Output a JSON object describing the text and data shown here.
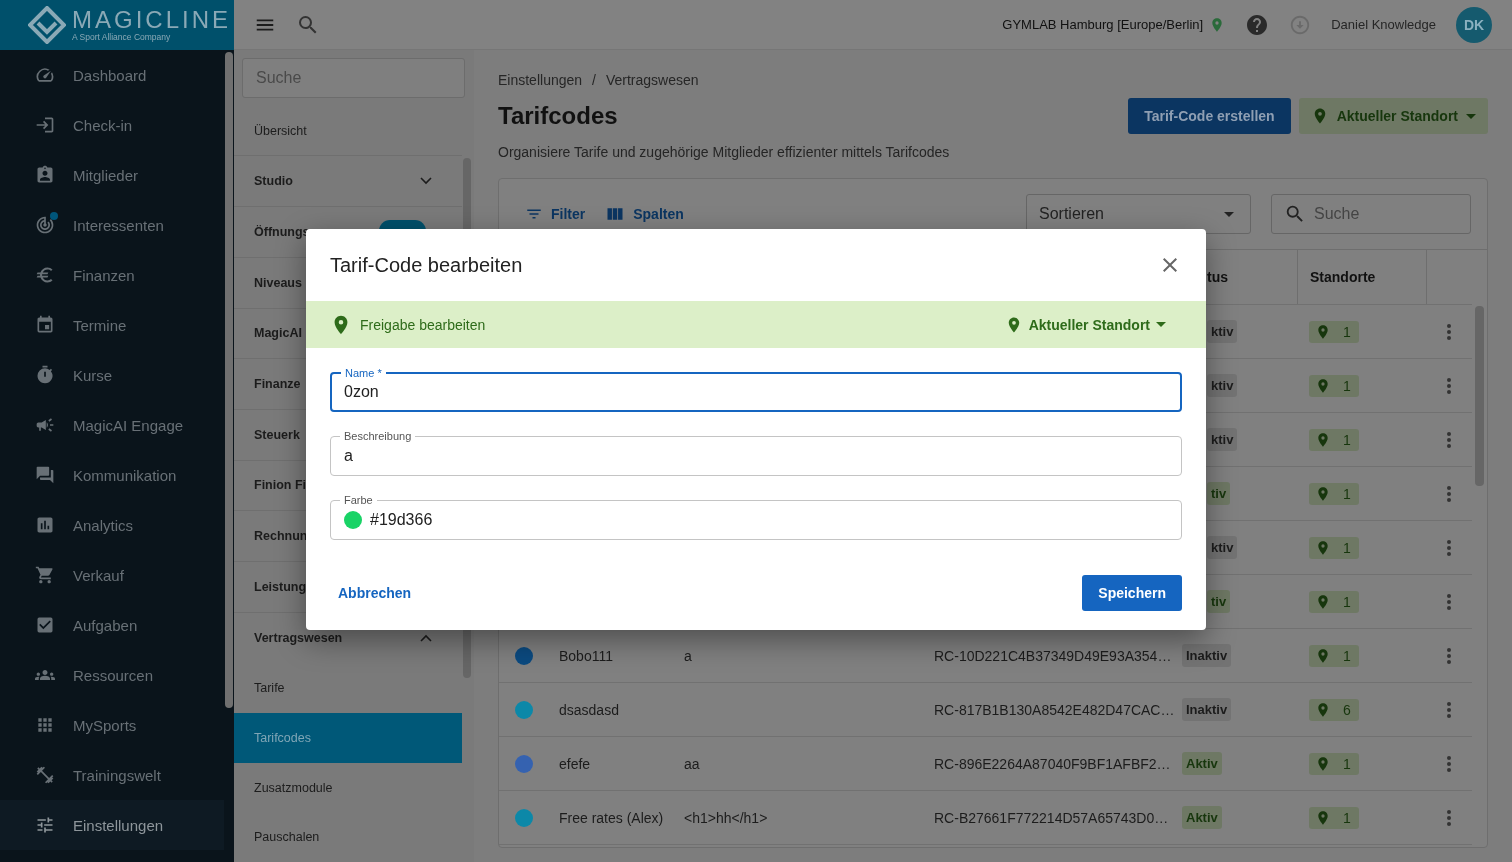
{
  "app": {
    "logo": "MAGICLINE",
    "tagline": "A Sport Alliance Company"
  },
  "topbar": {
    "location": "GYMLAB Hamburg [Europe/Berlin]",
    "user": "Daniel Knowledge",
    "avatar": "DK"
  },
  "nav": [
    {
      "label": "Dashboard",
      "selected": false,
      "notification": false
    },
    {
      "label": "Check-in",
      "selected": false,
      "notification": false
    },
    {
      "label": "Mitglieder",
      "selected": false,
      "notification": false
    },
    {
      "label": "Interessenten",
      "selected": false,
      "notification": true
    },
    {
      "label": "Finanzen",
      "selected": false,
      "notification": false
    },
    {
      "label": "Termine",
      "selected": false,
      "notification": false
    },
    {
      "label": "Kurse",
      "selected": false,
      "notification": false
    },
    {
      "label": "MagicAI Engage",
      "selected": false,
      "notification": false
    },
    {
      "label": "Kommunikation",
      "selected": false,
      "notification": false
    },
    {
      "label": "Analytics",
      "selected": false,
      "notification": false
    },
    {
      "label": "Verkauf",
      "selected": false,
      "notification": false
    },
    {
      "label": "Aufgaben",
      "selected": false,
      "notification": false
    },
    {
      "label": "Ressourcen",
      "selected": false,
      "notification": false
    },
    {
      "label": "MySports",
      "selected": false,
      "notification": false
    },
    {
      "label": "Trainingswelt",
      "selected": false,
      "notification": false
    },
    {
      "label": "Einstellungen",
      "selected": true,
      "notification": false
    }
  ],
  "settings_nav": {
    "search_placeholder": "Suche",
    "items": [
      {
        "kind": "link",
        "label": "Übersicht",
        "selected": false
      },
      {
        "kind": "group",
        "label": "Studio",
        "expanded": false,
        "badge": false
      },
      {
        "kind": "group",
        "label": "Öffnungs",
        "badge": true
      },
      {
        "kind": "group",
        "label": "Niveaus",
        "badge": false
      },
      {
        "kind": "group",
        "label": "MagicAI",
        "badge": false
      },
      {
        "kind": "group",
        "label": "Finanze",
        "badge": false
      },
      {
        "kind": "group",
        "label": "Steuerk",
        "badge": false
      },
      {
        "kind": "group",
        "label": "Finion Fi",
        "badge": false
      },
      {
        "kind": "group",
        "label": "Rechnun",
        "badge": false
      },
      {
        "kind": "group",
        "label": "Leistung",
        "badge": false
      },
      {
        "kind": "group",
        "label": "Vertragswesen",
        "expanded": true,
        "badge": false,
        "children": [
          {
            "label": "Tarife",
            "selected": false
          },
          {
            "label": "Tarifcodes",
            "selected": true
          },
          {
            "label": "Zusatzmodule",
            "selected": false
          },
          {
            "label": "Pauschalen",
            "selected": false
          }
        ]
      }
    ]
  },
  "main": {
    "breadcrumb": [
      "Einstellungen",
      "Vertragswesen"
    ],
    "breadcrumb_separator": "/",
    "title": "Tarifcodes",
    "subtitle": "Organisiere Tarife und zugehörige Mitglieder effizienter mittels Tarifcodes",
    "create_button": "Tarif-Code erstellen",
    "location_button": "Aktueller Standort",
    "toolbar": {
      "filter": "Filter",
      "columns": "Spalten",
      "sort_placeholder": "Sortieren",
      "search_placeholder": "Suche"
    },
    "table": {
      "columns": [
        {
          "label": "tus"
        },
        {
          "label": "Standorte"
        }
      ],
      "rows": [
        {
          "kind": "covered",
          "status": "ktiv",
          "active": false,
          "locations": "1"
        },
        {
          "kind": "covered",
          "status": "ktiv",
          "active": false,
          "locations": "1"
        },
        {
          "kind": "covered",
          "status": "ktiv",
          "active": false,
          "locations": "1"
        },
        {
          "kind": "covered",
          "status": "tiv",
          "active": true,
          "locations": "1"
        },
        {
          "kind": "covered",
          "status": "ktiv",
          "active": false,
          "locations": "1"
        },
        {
          "kind": "covered",
          "status": "tiv",
          "active": true,
          "locations": "1"
        },
        {
          "kind": "full",
          "color": "#0b4a80",
          "name": "Bobo111",
          "description": "a",
          "code": "RC-10D221C4B37349D49E93A354…",
          "status": "Inaktiv",
          "active": false,
          "locations": "1"
        },
        {
          "kind": "full",
          "color": "#0c88a8",
          "name": "dsasdasd",
          "code": "RC-817B1B130A8542E482D47CAC…",
          "status": "Inaktiv",
          "active": false,
          "locations": "6"
        },
        {
          "kind": "full",
          "color": "#3562b0",
          "name": "efefe",
          "description": "aa",
          "code": "RC-896E2264A87040F9BF1AFBF2…",
          "status": "Aktiv",
          "active": true,
          "locations": "1"
        },
        {
          "kind": "full",
          "color": "#0c88a8",
          "name": "Free rates (Alex)",
          "description": "<h1>hh</h1>",
          "code": "RC-B27661F772214D57A65743D0…",
          "status": "Aktiv",
          "active": true,
          "locations": "1"
        }
      ]
    }
  },
  "dialog": {
    "title": "Tarif-Code bearbeiten",
    "share": {
      "label": "Freigabe bearbeiten",
      "location": "Aktueller Standort"
    },
    "fields": [
      {
        "kind": "text",
        "label": "Name *",
        "value": "0zon",
        "focused": true
      },
      {
        "kind": "text",
        "label": "Beschreibung",
        "value": "a",
        "focused": false
      },
      {
        "kind": "color",
        "label": "Farbe",
        "value": "#19d366",
        "color": "#19d366",
        "focused": false
      }
    ],
    "cancel": "Abbrechen",
    "save": "Speichern"
  }
}
